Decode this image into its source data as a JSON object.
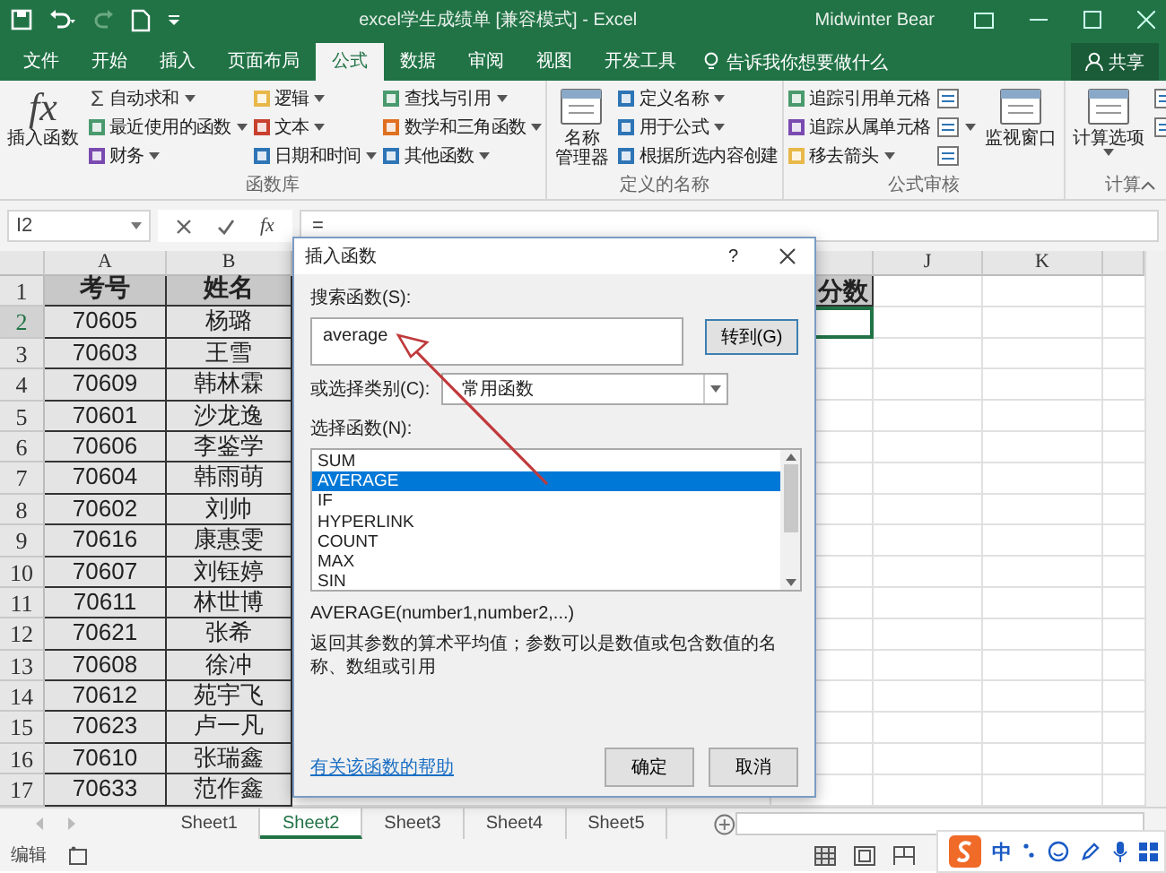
{
  "title_bar": {
    "title": "excel学生成绩单 [兼容模式] - Excel",
    "user": "Midwinter Bear"
  },
  "ribbon_tabs": [
    {
      "label": "文件",
      "selected": false
    },
    {
      "label": "开始",
      "selected": false
    },
    {
      "label": "插入",
      "selected": false
    },
    {
      "label": "页面布局",
      "selected": false
    },
    {
      "label": "公式",
      "selected": true
    },
    {
      "label": "数据",
      "selected": false
    },
    {
      "label": "审阅",
      "selected": false
    },
    {
      "label": "视图",
      "selected": false
    },
    {
      "label": "开发工具",
      "selected": false
    }
  ],
  "tell_me": "告诉我你想要做什么",
  "share": "共享",
  "ribbon_groups": [
    {
      "label": "函数库",
      "columns": [
        [
          {
            "kind": "large",
            "glyph": "fx",
            "lines": [
              "插入函数"
            ]
          }
        ],
        [
          {
            "kind": "small",
            "glyph": "Σ",
            "label": "自动求和",
            "dropdown": true
          },
          {
            "kind": "small",
            "label": "最近使用的函数",
            "dropdown": true
          },
          {
            "kind": "small",
            "label": "财务",
            "dropdown": true
          }
        ],
        [
          {
            "kind": "small",
            "label": "逻辑",
            "dropdown": true
          },
          {
            "kind": "small",
            "label": "文本",
            "dropdown": true
          },
          {
            "kind": "small",
            "label": "日期和时间",
            "dropdown": true
          }
        ],
        [
          {
            "kind": "small",
            "label": "查找与引用",
            "dropdown": true
          },
          {
            "kind": "small",
            "label": "数学和三角函数",
            "dropdown": true
          },
          {
            "kind": "small",
            "label": "其他函数",
            "dropdown": true
          }
        ]
      ]
    },
    {
      "label": "定义的名称",
      "columns": [
        [
          {
            "kind": "large",
            "lines": [
              "名称",
              "管理器"
            ]
          }
        ],
        [
          {
            "kind": "small",
            "label": "定义名称",
            "dropdown": true
          },
          {
            "kind": "small",
            "label": "用于公式",
            "dropdown": true
          },
          {
            "kind": "small",
            "label": "根据所选内容创建"
          }
        ]
      ]
    },
    {
      "label": "公式审核",
      "columns": [
        [
          {
            "kind": "small",
            "label": "追踪引用单元格"
          },
          {
            "kind": "small",
            "label": "追踪从属单元格"
          },
          {
            "kind": "small",
            "label": "移去箭头",
            "dropdown": true
          }
        ],
        [
          {
            "kind": "icon"
          },
          {
            "kind": "icon",
            "dropdown": true
          },
          {
            "kind": "icon"
          }
        ],
        [
          {
            "kind": "large",
            "lines": [
              "监视窗口"
            ]
          }
        ]
      ]
    },
    {
      "label": "计算",
      "columns": [
        [
          {
            "kind": "large",
            "lines": [
              "计算选项"
            ],
            "dropdown": true
          }
        ],
        [
          {
            "kind": "icon"
          },
          {
            "kind": "icon"
          }
        ]
      ]
    }
  ],
  "formula_bar": {
    "name_box": "I2",
    "fx": "fx",
    "formula": "="
  },
  "sheet": {
    "columns": [
      "A",
      "B",
      "J",
      "K"
    ],
    "rows": [
      {
        "header": "1",
        "kind": "header",
        "cells": [
          "考号",
          "姓名"
        ],
        "cell_i": "分数",
        "selected": false
      },
      {
        "header": "2",
        "cells": [
          "70605",
          "杨璐"
        ],
        "selected": true
      },
      {
        "header": "3",
        "cells": [
          "70603",
          "王雪"
        ],
        "selected": false
      },
      {
        "header": "4",
        "cells": [
          "70609",
          "韩林霖"
        ],
        "selected": false
      },
      {
        "header": "5",
        "cells": [
          "70601",
          "沙龙逸"
        ],
        "selected": false
      },
      {
        "header": "6",
        "cells": [
          "70606",
          "李鉴学"
        ],
        "selected": false
      },
      {
        "header": "7",
        "cells": [
          "70604",
          "韩雨萌"
        ],
        "selected": false
      },
      {
        "header": "8",
        "cells": [
          "70602",
          "刘帅"
        ],
        "selected": false
      },
      {
        "header": "9",
        "cells": [
          "70616",
          "康惠雯"
        ],
        "selected": false
      },
      {
        "header": "10",
        "cells": [
          "70607",
          "刘钰婷"
        ],
        "selected": false
      },
      {
        "header": "11",
        "cells": [
          "70611",
          "林世博"
        ],
        "selected": false
      },
      {
        "header": "12",
        "cells": [
          "70621",
          "张希"
        ],
        "selected": false
      },
      {
        "header": "13",
        "cells": [
          "70608",
          "徐冲"
        ],
        "selected": false
      },
      {
        "header": "14",
        "cells": [
          "70612",
          "苑宇飞"
        ],
        "selected": false
      },
      {
        "header": "15",
        "cells": [
          "70623",
          "卢一凡"
        ],
        "selected": false
      },
      {
        "header": "16",
        "cells": [
          "70610",
          "张瑞鑫"
        ],
        "selected": false
      },
      {
        "header": "17",
        "cells": [
          "70633",
          "范作鑫"
        ],
        "selected": false
      }
    ]
  },
  "sheet_tabs": [
    {
      "label": "Sheet1",
      "selected": false
    },
    {
      "label": "Sheet2",
      "selected": true
    },
    {
      "label": "Sheet3",
      "selected": false
    },
    {
      "label": "Sheet4",
      "selected": false
    },
    {
      "label": "Sheet5",
      "selected": false
    }
  ],
  "status_bar": {
    "mode": "编辑"
  },
  "dialog": {
    "title": "插入函数",
    "help": "?",
    "search_label": "搜索函数(S):",
    "search_value": "average",
    "go_button": "转到(G)",
    "category_label": "或选择类别(C):",
    "category": "常用函数",
    "list_label": "选择函数(N):",
    "functions": [
      {
        "label": "SUM",
        "selected": false
      },
      {
        "label": "AVERAGE",
        "selected": true
      },
      {
        "label": "IF",
        "selected": false
      },
      {
        "label": "HYPERLINK",
        "selected": false
      },
      {
        "label": "COUNT",
        "selected": false
      },
      {
        "label": "MAX",
        "selected": false
      },
      {
        "label": "SIN",
        "selected": false
      }
    ],
    "signature": "AVERAGE(number1,number2,...)",
    "description": "返回其参数的算术平均值；参数可以是数值或包含数值的名称、数组或引用",
    "help_link": "有关该函数的帮助",
    "ok": "确定",
    "cancel": "取消"
  },
  "ime_bar": {
    "language": "中"
  }
}
